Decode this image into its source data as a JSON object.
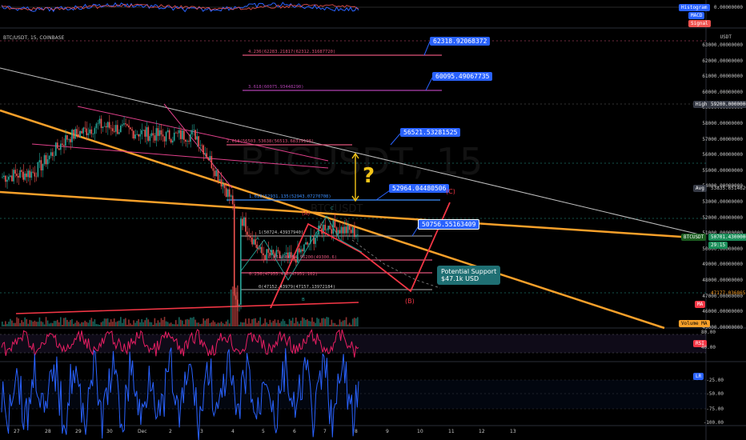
{
  "symbol": {
    "title": "BTC/USDT, 15, COINBASE",
    "watermark_main": "BTCUSDT, 15",
    "watermark_sub": "BTC/USDT"
  },
  "macd": {
    "histogram_label": "Histogram",
    "macd_label": "MACD",
    "signal_label": "Signal",
    "zero_value": "0.00000000"
  },
  "price_axis": {
    "currency": "USDT",
    "ticks": [
      "63000.00000000",
      "62000.00000000",
      "61000.00000000",
      "60000.00000000",
      "59000.00000000",
      "58000.00000000",
      "57000.00000000",
      "56000.00000000",
      "55000.00000000",
      "54000.00000000",
      "53000.00000000",
      "52000.00000000",
      "51000.00000000",
      "50000.00000000",
      "49000.00000000",
      "48000.00000000",
      "47000.00000000",
      "46000.00000000",
      "45000.00000000"
    ],
    "high_label": "High",
    "high_value": "59200.00000000",
    "avg_label": "Avg",
    "avg_value": "53835.65146209",
    "last_label": "BTCUSDT",
    "last_value": "50701.43000000",
    "countdown": "29:15",
    "low_value": "47177.03686513",
    "ma_label": "MA",
    "volume_ma_label": "Volume MA"
  },
  "rsi": {
    "label": "RSI",
    "ticks": [
      "80.00",
      "40.00"
    ]
  },
  "lr": {
    "label": "LR",
    "ticks": [
      "-25.00",
      "-50.00",
      "-75.00",
      "-100.00"
    ]
  },
  "fib_levels": [
    {
      "text": "4.236(62283.21817(62312.31687720)",
      "color": "#e0547a"
    },
    {
      "text": "3.618(60075.93448290)",
      "color": "#b040b0"
    },
    {
      "text": "2.618(56503.53638(56513.68339198)",
      "color": "#e0547a"
    },
    {
      "text": "1.618(52931.135(52943.07270708)",
      "color": "#3c8fff"
    },
    {
      "text": "1(50724.43937940)",
      "color": "#c7c7c7"
    },
    {
      "text": "0.618(49354.96200(49300.6)",
      "color": "#e0547a"
    },
    {
      "text": "0.236(47955.416(47951.102)",
      "color": "#e0547a"
    },
    {
      "text": "0(47152.43979(47157.13972184)",
      "color": "#c7c7c7"
    }
  ],
  "callouts": [
    "62318.92068372",
    "60095.49067735",
    "56521.53281525",
    "52964.04480506",
    "50756.55163409"
  ],
  "support": {
    "line1": "Potential Support",
    "line2": "$47.1k USD"
  },
  "waves": {
    "a": "A",
    "b": "B",
    "c": "C",
    "big_a": "(A)",
    "big_b": "(B)",
    "big_c": "(C)",
    "question": "?"
  },
  "time_axis": [
    "27",
    "28",
    "29",
    "30",
    "Dec",
    "2",
    "3",
    "4",
    "5",
    "6",
    "7",
    "8",
    "9",
    "10",
    "11",
    "12",
    "13"
  ],
  "chart_data": {
    "type": "line",
    "title": "BTC/USDT, 15, COINBASE",
    "xlabel": "",
    "ylabel": "USDT",
    "ylim": [
      45000,
      63500
    ],
    "grid": true,
    "series": [
      {
        "name": "BTCUSDT",
        "x": [
          "27",
          "28",
          "29",
          "30",
          "Dec",
          "2",
          "3",
          "4",
          "5",
          "6",
          "7",
          "8"
        ],
        "values": [
          54300,
          54600,
          56800,
          57600,
          57200,
          56900,
          57000,
          53200,
          49400,
          49000,
          51200,
          50701
        ]
      }
    ],
    "annotations": [
      "Potential Support $47.1k USD"
    ]
  },
  "colors": {
    "accent_blue": "#2962ff",
    "trend_orange": "#f7a02a",
    "wave_red": "#f23645",
    "up": "#26a69a",
    "down": "#ef5350"
  }
}
